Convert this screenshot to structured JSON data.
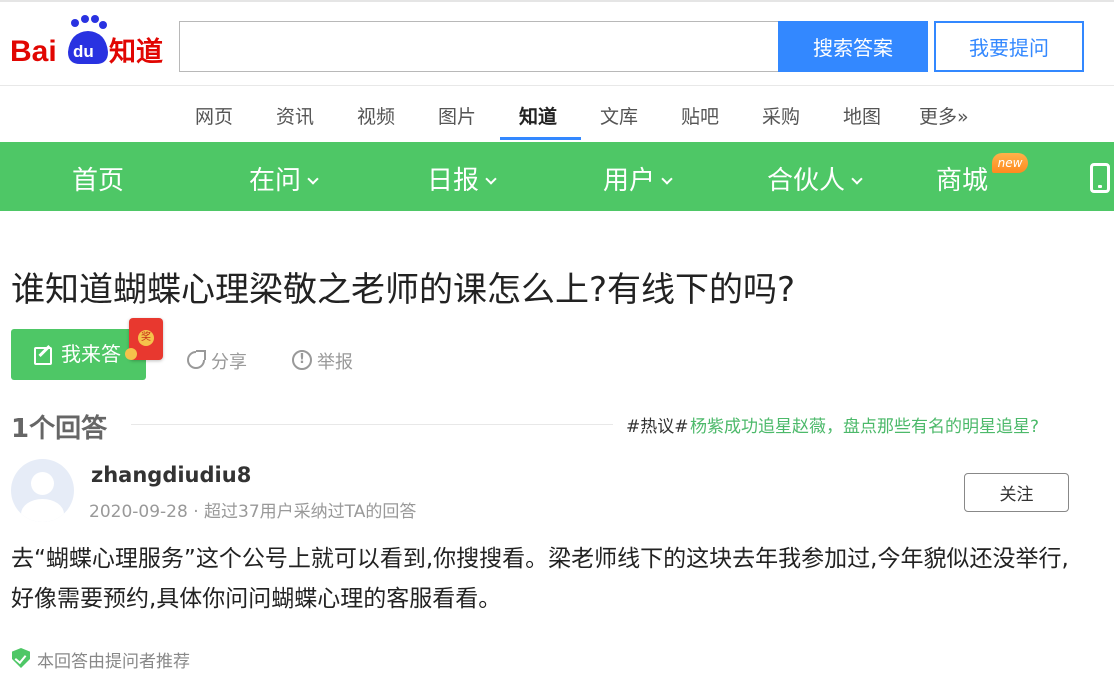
{
  "header": {
    "logo_text": "Bai du 知道",
    "search_placeholder": "",
    "search_button": "搜索答案",
    "ask_button": "我要提问"
  },
  "product_nav": {
    "items": [
      "网页",
      "资讯",
      "视频",
      "图片",
      "知道",
      "文库",
      "贴吧",
      "采购",
      "地图",
      "更多»"
    ],
    "active": "知道"
  },
  "green_nav": {
    "items": [
      "首页",
      "在问",
      "日报",
      "用户",
      "合伙人",
      "商城"
    ],
    "new_badge": "new"
  },
  "question": {
    "title": "谁知道蝴蝶心理梁敬之老师的课怎么上?有线下的吗?",
    "answer_button": "我来答",
    "share": "分享",
    "report": "举报"
  },
  "answers": {
    "count_label": "1个回答",
    "hot_tag": "#热议#",
    "hot_link": "杨紫成功追星赵薇，盘点那些有名的明星追星?"
  },
  "answer": {
    "username": "zhangdiudiu8",
    "meta": "2020-09-28 · 超过37用户采纳过TA的回答",
    "follow_button": "关注",
    "text": "去“蝴蝶心理服务”这个公号上就可以看到,你搜搜看。梁老师线下的这块去年我参加过,今年貌似还没举行,好像需要预约,具体你问问蝴蝶心理的客服看看。",
    "recommend": "本回答由提问者推荐"
  },
  "colors": {
    "brand_blue": "#3388ff",
    "nav_green": "#4ec766",
    "logo_red": "#e10602"
  }
}
